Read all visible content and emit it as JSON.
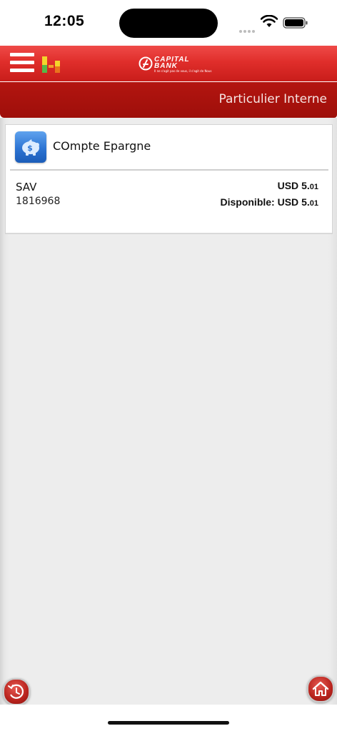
{
  "status_bar": {
    "time": "12:05"
  },
  "header": {
    "logo_line1": "CAPITAL",
    "logo_line2": "BANK",
    "logo_tagline": "Il ne s'agit pas de vous, il s'agit de Nous",
    "brand_color": "#e02e2b"
  },
  "title_bar": {
    "title": "Particulier Interne",
    "color": "#9e0f0a"
  },
  "account_card": {
    "title": "COmpte Epargne",
    "type": "SAV",
    "number": "1816968",
    "balance_currency": "USD",
    "balance_main": "5.",
    "balance_cents": "01",
    "available_label": "Disponible:",
    "available_currency": "USD",
    "available_main": "5.",
    "available_cents": "01"
  },
  "icons": {
    "menu": "hamburger-menu-icon",
    "chart": "bar-chart-icon",
    "card": "piggy-bank-icon",
    "history": "history-icon",
    "home": "home-icon"
  }
}
